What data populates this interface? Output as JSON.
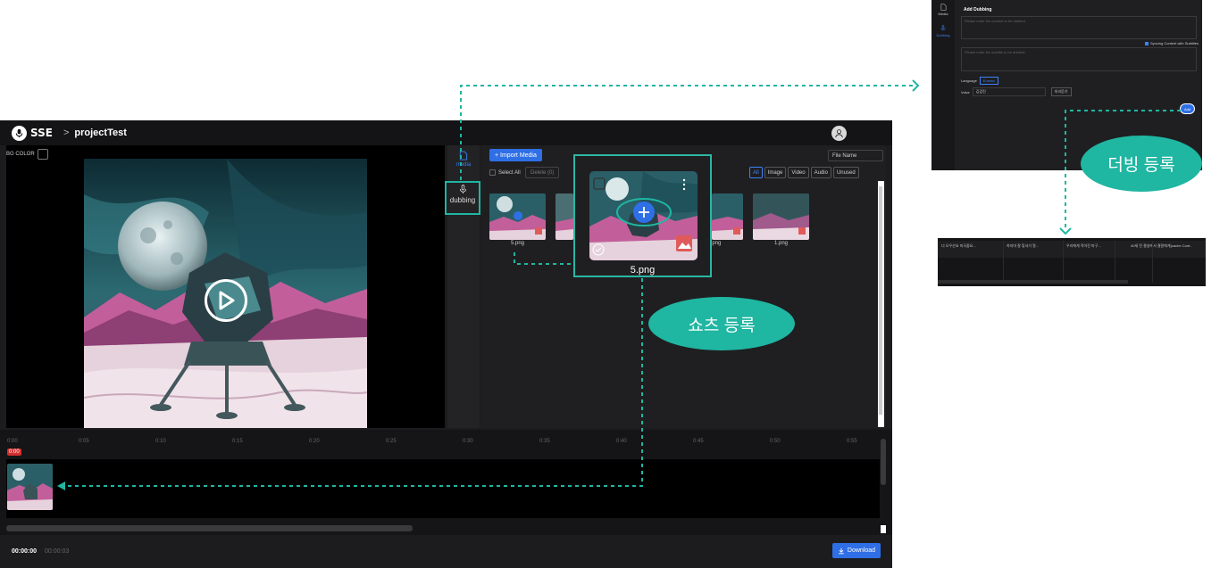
{
  "app": {
    "brand": "SSE",
    "breadcrumb_sep": ">",
    "project_title": "projectTest",
    "bg_color_label": "BG COLOR"
  },
  "side_tabs": {
    "media": "media",
    "dubbing": "dubbing"
  },
  "media_panel": {
    "import_label": "+ Import Media",
    "sort_value": "File Name",
    "select_all": "Select All",
    "delete_label": "Delete (0)",
    "filters": [
      "All",
      "Image",
      "Video",
      "Audio",
      "Unused"
    ],
    "items": [
      {
        "name": "5.png"
      },
      {
        "name": ".png"
      },
      {
        "name": "1.png"
      }
    ]
  },
  "popup": {
    "label": "5.png"
  },
  "timeline": {
    "ticks": [
      "0:00",
      "0:05",
      "0:10",
      "0:15",
      "0:20",
      "0:25",
      "0:30",
      "0:35",
      "0:40",
      "0:45",
      "0:50",
      "0:55"
    ],
    "playhead": "0:00"
  },
  "footer": {
    "current_time": "00:00:00",
    "total_time": "00:00:03",
    "download_label": "Download"
  },
  "dub_dialog": {
    "sidebar": [
      "Media",
      "Dubbing"
    ],
    "title": "Add Dubbing",
    "content_placeholder": "Please enter the content to be dubbed.",
    "sync_label": "Syncing Content with Subtitles",
    "subtitle_placeholder": "Please enter the subtitle to be dubbed.",
    "language_label": "Language",
    "language_value": "Korean",
    "voice_label": "Voice",
    "voice_value": "김갑진",
    "preview_label": "미리듣기",
    "add_label": "Add"
  },
  "subtitle_strip": {
    "items": [
      "너 오우산요 미국중요...",
      "하지마 잘 맞서기 알...",
      "우리에게 작아진 마구...",
      "40세 전 결실에서 결말에게(cache Cont..."
    ]
  },
  "annotations": {
    "source_register": "쇼츠 등록",
    "dubbing_register": "더빙 등록"
  },
  "colors": {
    "accent": "#2f6fe6",
    "annotation": "#1fb6a2",
    "background": "#1c1c1e"
  }
}
